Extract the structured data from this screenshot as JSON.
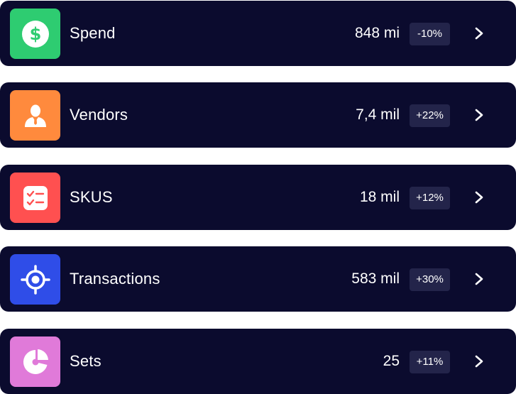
{
  "rows": [
    {
      "label": "Spend",
      "value": "848 mi",
      "change": "-10%",
      "icon": "dollar-icon",
      "color": "#2ecc71"
    },
    {
      "label": "Vendors",
      "value": "7,4 mil",
      "change": "+22%",
      "icon": "user-icon",
      "color": "#ff8a3d"
    },
    {
      "label": "SKUS",
      "value": "18 mil",
      "change": "+12%",
      "icon": "checklist-icon",
      "color": "#ff5050"
    },
    {
      "label": "Transactions",
      "value": "583 mil",
      "change": "+30%",
      "icon": "target-icon",
      "color": "#2f4de8"
    },
    {
      "label": "Sets",
      "value": "25",
      "change": "+11%",
      "icon": "pie-chart-icon",
      "color": "#e07ad9"
    }
  ]
}
